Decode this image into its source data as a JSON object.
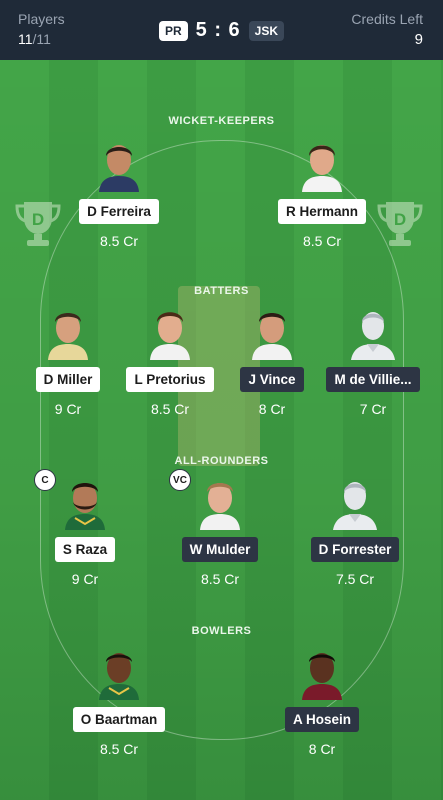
{
  "header": {
    "players_label": "Players",
    "players_count": "11",
    "players_total": "/11",
    "team_left": "PR",
    "score": "5 : 6",
    "team_right": "JSK",
    "credits_label": "Credits Left",
    "credits_value": "9"
  },
  "sections": {
    "wk": "WICKET-KEEPERS",
    "bat": "BATTERS",
    "ar": "ALL-ROUNDERS",
    "bowl": "BOWLERS"
  },
  "players": {
    "wk": [
      {
        "name": "D Ferreira",
        "credits": "8.5 Cr"
      },
      {
        "name": "R Hermann",
        "credits": "8.5 Cr"
      }
    ],
    "bat": [
      {
        "name": "D Miller",
        "credits": "9 Cr"
      },
      {
        "name": "L Pretorius",
        "credits": "8.5 Cr"
      },
      {
        "name": "J Vince",
        "credits": "8 Cr"
      },
      {
        "name": "M de Villie...",
        "credits": "7 Cr"
      }
    ],
    "ar": [
      {
        "name": "S Raza",
        "credits": "9 Cr",
        "badge": "C"
      },
      {
        "name": "W Mulder",
        "credits": "8.5 Cr",
        "badge": "VC"
      },
      {
        "name": "D Forrester",
        "credits": "7.5 Cr"
      }
    ],
    "bowl": [
      {
        "name": "O Baartman",
        "credits": "8.5 Cr"
      },
      {
        "name": "A Hosein",
        "credits": "8 Cr"
      }
    ]
  },
  "colors": {
    "header_bg": "#1f2a38",
    "field_green": "#43a548",
    "tag_light": "#ffffff",
    "tag_dark": "#2d3544"
  }
}
